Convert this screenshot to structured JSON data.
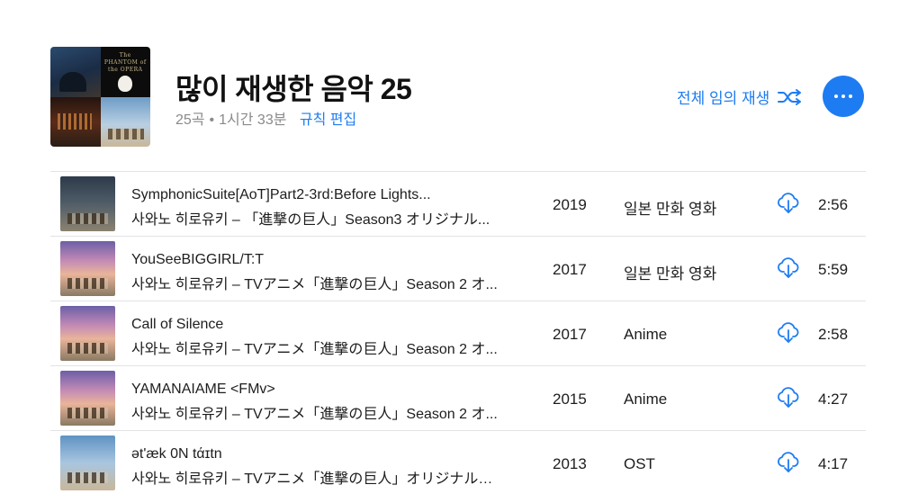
{
  "playlist": {
    "title": "많이 재생한 음악 25",
    "song_count": "25곡",
    "separator": "•",
    "duration": "1시간 33분",
    "edit_rules_label": "규칙 편집",
    "cover_text": "The PHANTOM of the OPERA"
  },
  "actions": {
    "shuffle_all_label": "전체 임의 재생",
    "shuffle_icon": "shuffle-icon",
    "more_icon": "ellipsis-icon"
  },
  "colors": {
    "accent": "#1e7cf2",
    "secondary_text": "#8a8a8e",
    "divider": "#e3e3e6"
  },
  "tracks": [
    {
      "title": "SymphonicSuite[AoT]Part2-3rd:Before Lights...",
      "artist": "사와노 히로유키 – 「進撃の巨人」Season3 オリジナル...",
      "year": "2019",
      "genre": "일본 만화 영화",
      "duration": "2:56",
      "icon": "cloud-download-icon"
    },
    {
      "title": "YouSeeBIGGIRL/T:T",
      "artist": "사와노 히로유키 – TVアニメ「進撃の巨人」Season 2 オ...",
      "year": "2017",
      "genre": "일본 만화 영화",
      "duration": "5:59",
      "icon": "cloud-download-icon"
    },
    {
      "title": "Call of Silence",
      "artist": "사와노 히로유키 – TVアニメ「進撃の巨人」Season 2 オ...",
      "year": "2017",
      "genre": "Anime",
      "duration": "2:58",
      "icon": "cloud-download-icon"
    },
    {
      "title": "YAMANAIAME <FMv>",
      "artist": "사와노 히로유키 – TVアニメ「進撃の巨人」Season 2 オ...",
      "year": "2015",
      "genre": "Anime",
      "duration": "4:27",
      "icon": "cloud-download-icon"
    },
    {
      "title": "ət'æk 0N tάɪtn",
      "artist": "사와노 히로유키 – TVアニメ「進撃の巨人」オリジナルサ...",
      "year": "2013",
      "genre": "OST",
      "duration": "4:17",
      "icon": "cloud-download-icon"
    }
  ]
}
